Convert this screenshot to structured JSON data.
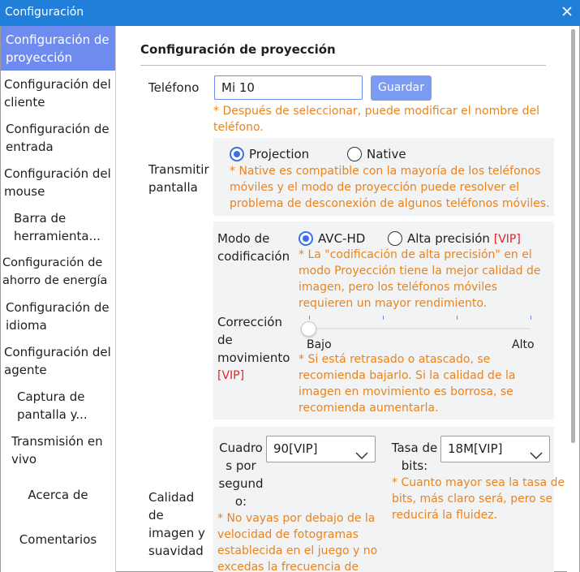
{
  "window": {
    "title": "Configuración"
  },
  "sidebar": {
    "items": [
      {
        "label": "Configuración de proyección",
        "active": true
      },
      {
        "label": "Configuración del cliente"
      },
      {
        "label": "Configuración de entrada"
      },
      {
        "label": "Configuración del mouse"
      },
      {
        "label": "Barra de herramienta..."
      },
      {
        "label": "Configuración de ahorro de energía"
      },
      {
        "label": "Configuración de idioma"
      },
      {
        "label": "Configuración del agente"
      },
      {
        "label": "Captura de pantalla y..."
      },
      {
        "label": "Transmisión en vivo"
      },
      {
        "label": "Acerca de"
      },
      {
        "label": "Comentarios"
      }
    ]
  },
  "main": {
    "section_title": "Configuración de proyección",
    "phone": {
      "label": "Teléfono",
      "value": "Mi 10",
      "save_label": "Guardar",
      "note_line1": "* Después de seleccionar, puede modificar el nombre del",
      "note_line2": "teléfono."
    },
    "screen": {
      "label_line1": "Transmitir",
      "label_line2": "pantalla",
      "option_projection": "Projection",
      "option_native": "Native",
      "selected": "Projection",
      "note_line1": "* Native es compatible con la mayoría de los teléfonos",
      "note_line2": "móviles y el modo de proyección puede resolver el",
      "note_line3": "problema de desconexión de algunos teléfonos móviles."
    },
    "encoding": {
      "label_line1": "Modo de",
      "label_line2": "codificación",
      "option_avc": "AVC-HD",
      "option_high": "Alta precisión",
      "vip_tag": "[VIP]",
      "selected": "AVC-HD",
      "note_line1": "* La \"codificación de alta precisión\" en el",
      "note_line2": "modo Proyección tiene la mejor calidad de",
      "note_line3": "imagen, pero los teléfonos móviles",
      "note_line4": "requieren un mayor rendimiento."
    },
    "motion": {
      "label_line1": "Corrección",
      "label_line2": "de",
      "label_line3": "movimiento",
      "vip_tag": "[VIP]",
      "min_label": "Bajo",
      "max_label": "Alto",
      "level": 0,
      "note_line1": "* Si está retrasado o atascado, se",
      "note_line2": "recomienda bajarlo. Si la calidad de la",
      "note_line3": "imagen en movimiento es borrosa, se",
      "note_line4": "recomienda aumentarla."
    },
    "quality": {
      "label_line1": "Calidad",
      "label_line2": "de",
      "label_line3": "imagen y",
      "label_line4": "suavidad",
      "fps_label_line1": "Cuadro",
      "fps_label_line2": "s por",
      "fps_label_line3": "segund",
      "fps_label_line4": "o:",
      "fps_value": "90[VIP]",
      "fps_note_line1": "* No vayas por debajo de la",
      "fps_note_line2": "velocidad de fotogramas",
      "fps_note_line3": "establecida en el juego y no",
      "fps_note_line4": "excedas la frecuencia de",
      "bitrate_label_line1": "Tasa de",
      "bitrate_label_line2": "bits:",
      "bitrate_value": "18M[VIP]",
      "bitrate_note_line1": "* Cuanto mayor sea la tasa de",
      "bitrate_note_line2": "bits, más claro será, pero se",
      "bitrate_note_line3": "reducirá la fluidez."
    }
  },
  "colors": {
    "titlebar": "#1f7fd9",
    "active_nav": "#6e8cf0",
    "note": "#e8841f",
    "vip": "#e02424",
    "radio_selected": "#3b6fe4"
  }
}
